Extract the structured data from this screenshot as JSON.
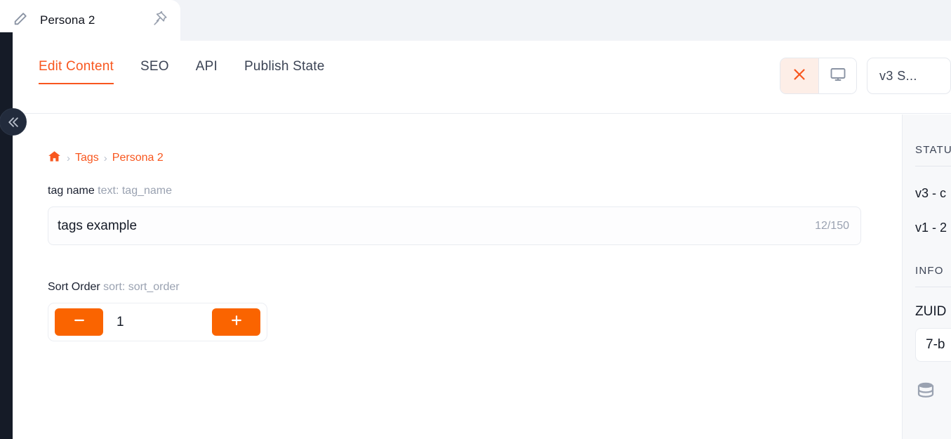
{
  "tab_bar": {
    "active_tab": {
      "title": "Persona 2",
      "edit_icon": "pencil-icon",
      "pin_icon": "pin-icon"
    }
  },
  "toolbar": {
    "tabs": [
      {
        "label": "Edit Content",
        "active": true
      },
      {
        "label": "SEO",
        "active": false
      },
      {
        "label": "API",
        "active": false
      },
      {
        "label": "Publish State",
        "active": false
      }
    ],
    "close_icon": "close-icon",
    "preview_icon": "monitor-icon",
    "version_button_label": "v3  S...",
    "collapse_icon": "double-chevron-left-icon"
  },
  "breadcrumb": {
    "home_icon": "home-icon",
    "separator": "›",
    "items": [
      {
        "label": "Tags"
      },
      {
        "label": "Persona 2"
      }
    ]
  },
  "fields": {
    "tag_name": {
      "label": "tag name",
      "meta": "text: tag_name",
      "value": "tags example",
      "placeholder": "",
      "char_count": "12/150"
    },
    "sort_order": {
      "label": "Sort Order",
      "meta": "sort: sort_order",
      "value": "1",
      "minus_icon": "minus-icon",
      "plus_icon": "plus-icon"
    }
  },
  "right_panel": {
    "status_header": "STATUS",
    "status_rows": [
      {
        "label": "v3 - c"
      },
      {
        "label": "v1 - 2"
      }
    ],
    "info_header": "INFO",
    "zuid_label": "ZUID",
    "zuid_value": "7-b",
    "db_icon": "database-icon"
  },
  "colors": {
    "accent": "#f8571f",
    "accent_solid": "#fa6400",
    "accent_soft": "#fdeee7",
    "rail_dark": "#151b27",
    "tabstrip_bg": "#f1f3f7",
    "panel_bg": "#f7f8fa",
    "text_dark": "#151b27",
    "text_muted": "#9aa2b1",
    "border": "#e9ecf1"
  }
}
